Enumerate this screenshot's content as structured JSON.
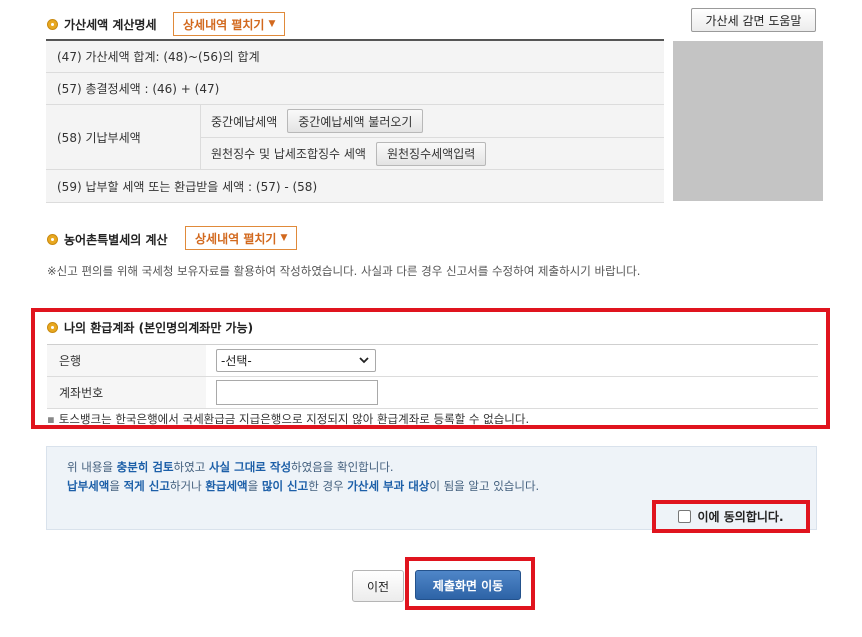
{
  "penalty_section": {
    "title": "가산세액 계산명세",
    "expand_label": "상세내역 펼치기",
    "help_button": "가산세 감면 도움말"
  },
  "calc_rows": {
    "row47": "(47) 가산세액 합계: (48)~(56)의 합계",
    "row57": "(57) 총결정세액 : (46) + (47)",
    "row58_label": "(58) 기납부세액",
    "row58_sub1_label": "중간예납세액",
    "row58_sub1_button": "중간예납세액 불러오기",
    "row58_sub2_label": "원천징수 및 납세조합징수 세액",
    "row58_sub2_button": "원천징수세액입력",
    "row59": "(59) 납부할 세액 또는 환급받을 세액 : (57) - (58)"
  },
  "rural_section": {
    "title": "농어촌특별세의 계산",
    "expand_label": "상세내역 펼치기"
  },
  "notice": "※신고 편의를 위해 국세청 보유자료를 활용하여 작성하였습니다. 사실과 다른 경우 신고서를 수정하여 제출하시기 바랍니다.",
  "refund": {
    "title": "나의 환급계좌 (본인명의계좌만 가능)",
    "bank_label": "은행",
    "bank_selected": "-선택-",
    "account_label": "계좌번호",
    "account_value": "",
    "note": "토스뱅크는 한국은행에서 국세환급금 지급은행으로 지정되지 않아 환급계좌로 등록할 수 없습니다."
  },
  "confirm": {
    "l1_a": "위 내용을 ",
    "l1_b": "충분히 검토",
    "l1_c": "하였고 ",
    "l1_d": "사실 그대로 작성",
    "l1_e": "하였음을 확인합니다.",
    "l2_a": "납부세액",
    "l2_b": "을 ",
    "l2_c": "적게 신고",
    "l2_d": "하거나 ",
    "l2_e": "환급세액",
    "l2_f": "을 ",
    "l2_g": "많이 신고",
    "l2_h": "한 경우 ",
    "l2_i": "가산세 부과 대상",
    "l2_j": "이 됨을 알고 있습니다.",
    "agree_label": "이에 동의합니다."
  },
  "nav": {
    "prev_label": "이전",
    "submit_label": "제출화면 이동"
  },
  "colors": {
    "accent_orange": "#d2691e",
    "highlight_red": "#e0141e",
    "submit_blue": "#2d63a6"
  }
}
